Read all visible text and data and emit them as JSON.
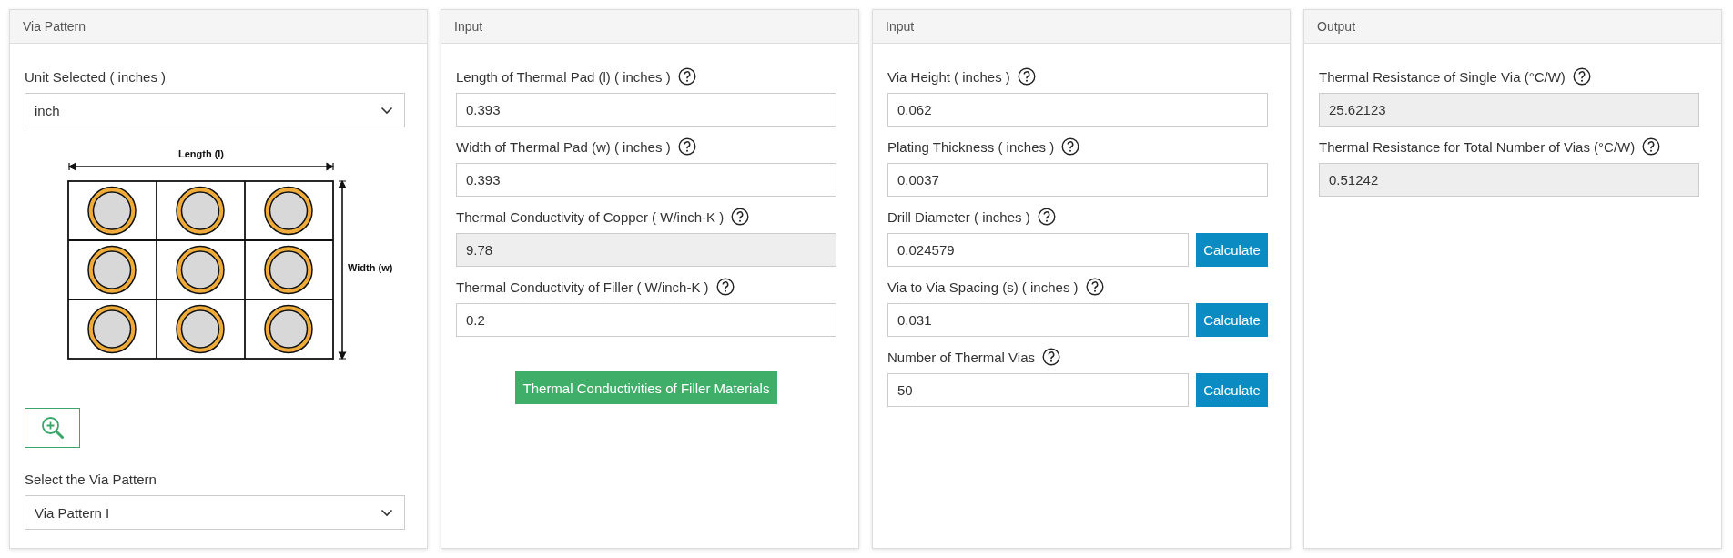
{
  "panels": [
    {
      "title": "Via Pattern",
      "items": [
        {
          "kind": "select",
          "label": "Unit Selected ( inches )",
          "value": "inch"
        },
        {
          "kind": "diagram",
          "length_label": "Length (l)",
          "width_label": "Width (w)"
        },
        {
          "kind": "zoom_button"
        },
        {
          "kind": "select",
          "label": "Select the Via Pattern",
          "value": "Via Pattern I"
        }
      ]
    },
    {
      "title": "Input",
      "items": [
        {
          "kind": "input",
          "label": "Length of Thermal Pad (l) ( inches )",
          "help": true,
          "value": "0.393",
          "readonly": false
        },
        {
          "kind": "input",
          "label": "Width of Thermal Pad (w) ( inches )",
          "help": true,
          "value": "0.393",
          "readonly": false
        },
        {
          "kind": "input",
          "label": "Thermal Conductivity of Copper ( W/inch-K )",
          "help": true,
          "value": "9.78",
          "readonly": true
        },
        {
          "kind": "input",
          "label": "Thermal Conductivity of Filler ( W/inch-K )",
          "help": true,
          "value": "0.2",
          "readonly": false
        },
        {
          "kind": "button",
          "label": "Thermal Conductivities of Filler Materials"
        }
      ]
    },
    {
      "title": "Input",
      "items": [
        {
          "kind": "input",
          "label": "Via Height ( inches )",
          "help": true,
          "value": "0.062",
          "readonly": false
        },
        {
          "kind": "input",
          "label": "Plating Thickness ( inches )",
          "help": true,
          "value": "0.0037",
          "readonly": false
        },
        {
          "kind": "input",
          "label": "Drill Diameter ( inches )",
          "help": true,
          "value": "0.024579",
          "readonly": false,
          "action": "Calculate"
        },
        {
          "kind": "input",
          "label": "Via to Via Spacing (s) ( inches )",
          "help": true,
          "value": "0.031",
          "readonly": false,
          "action": "Calculate"
        },
        {
          "kind": "input",
          "label": "Number of Thermal Vias",
          "help": true,
          "value": "50",
          "readonly": false,
          "action": "Calculate"
        }
      ]
    },
    {
      "title": "Output",
      "items": [
        {
          "kind": "input",
          "label": "Thermal Resistance of Single Via (°C/W)",
          "help": true,
          "value": "25.62123",
          "readonly": true
        },
        {
          "kind": "input",
          "label": "Thermal Resistance for Total Number of Vias (°C/W)",
          "help": true,
          "value": "0.51242",
          "readonly": true
        }
      ]
    }
  ]
}
